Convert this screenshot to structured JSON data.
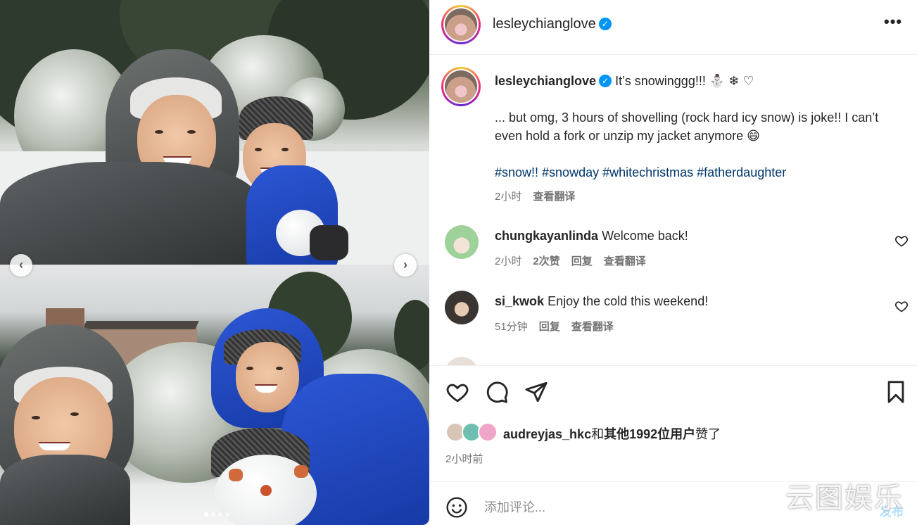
{
  "header": {
    "username": "lesleychianglove",
    "verified_mark": "✓",
    "more_glyph": "•••"
  },
  "carousel": {
    "prev_glyph": "‹",
    "next_glyph": "›",
    "dot_count": 4,
    "active_dot": 0
  },
  "caption": {
    "username": "lesleychianglove",
    "first_line": "It’s snowinggg!!! ⛄ ❄ ♡",
    "body": "... but omg, 3 hours of shovelling (rock hard icy snow) is joke!! I can’t even hold a fork or unzip my jacket anymore 😄",
    "hashtags": "#snow!! #snowday #whitechristmas #fatherdaughter",
    "time": "2小时",
    "translate_label": "查看翻译"
  },
  "comments": [
    {
      "username": "chungkayanlinda",
      "text": "Welcome back!",
      "time": "2小时",
      "likes": "2次赞",
      "reply_label": "回复",
      "translate_label": "查看翻译"
    },
    {
      "username": "si_kwok",
      "text": "Enjoy the cold this weekend!",
      "time": "51分钟",
      "reply_label": "回复",
      "translate_label": "查看翻译"
    }
  ],
  "likes": {
    "first_liker": "audreyjas_hkc",
    "connector": "和",
    "others": "其他1992位用户",
    "suffix": "赞了"
  },
  "post_time": "2小时前",
  "add_comment": {
    "placeholder": "添加评论...",
    "post_label": "发布"
  },
  "watermark": "云图娱乐",
  "colors": {
    "link": "#00376b",
    "verified": "#0095f6",
    "secondary_text": "#737373",
    "post_button": "#b2dffc"
  }
}
